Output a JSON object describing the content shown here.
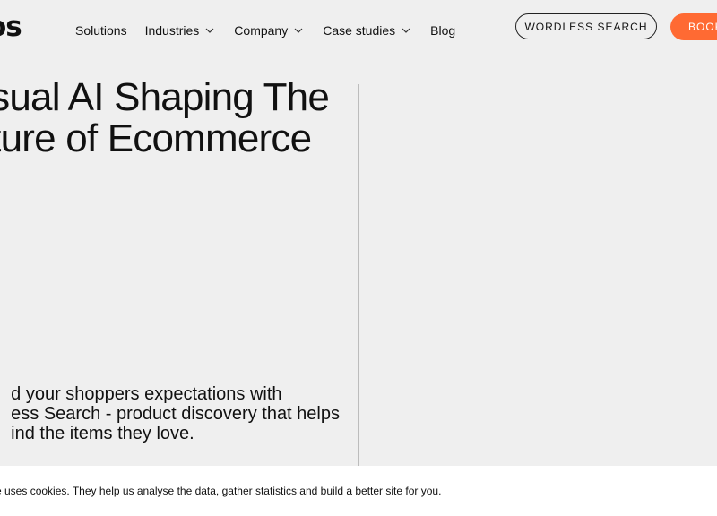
{
  "header": {
    "logo_text": "os",
    "nav": [
      {
        "label": "Solutions",
        "has_dropdown": false
      },
      {
        "label": "Industries",
        "has_dropdown": true
      },
      {
        "label": "Company",
        "has_dropdown": true
      },
      {
        "label": "Case studies",
        "has_dropdown": true
      },
      {
        "label": "Blog",
        "has_dropdown": false
      }
    ],
    "cta_outline_label": "WORDLESS SEARCH",
    "cta_fill_label": "BOOK",
    "cta_fill_color": "#ff6a33"
  },
  "hero": {
    "title_line1": "sual AI Shaping The",
    "title_line2": "ture of Ecommerce",
    "subtitle_line1": "d your shoppers expectations with",
    "subtitle_line2": "ess Search - product discovery that helps",
    "subtitle_line3": "ind the items they love."
  },
  "cookie": {
    "text": "e uses cookies. They help us analyse the data, gather statistics and build a better site for you."
  }
}
